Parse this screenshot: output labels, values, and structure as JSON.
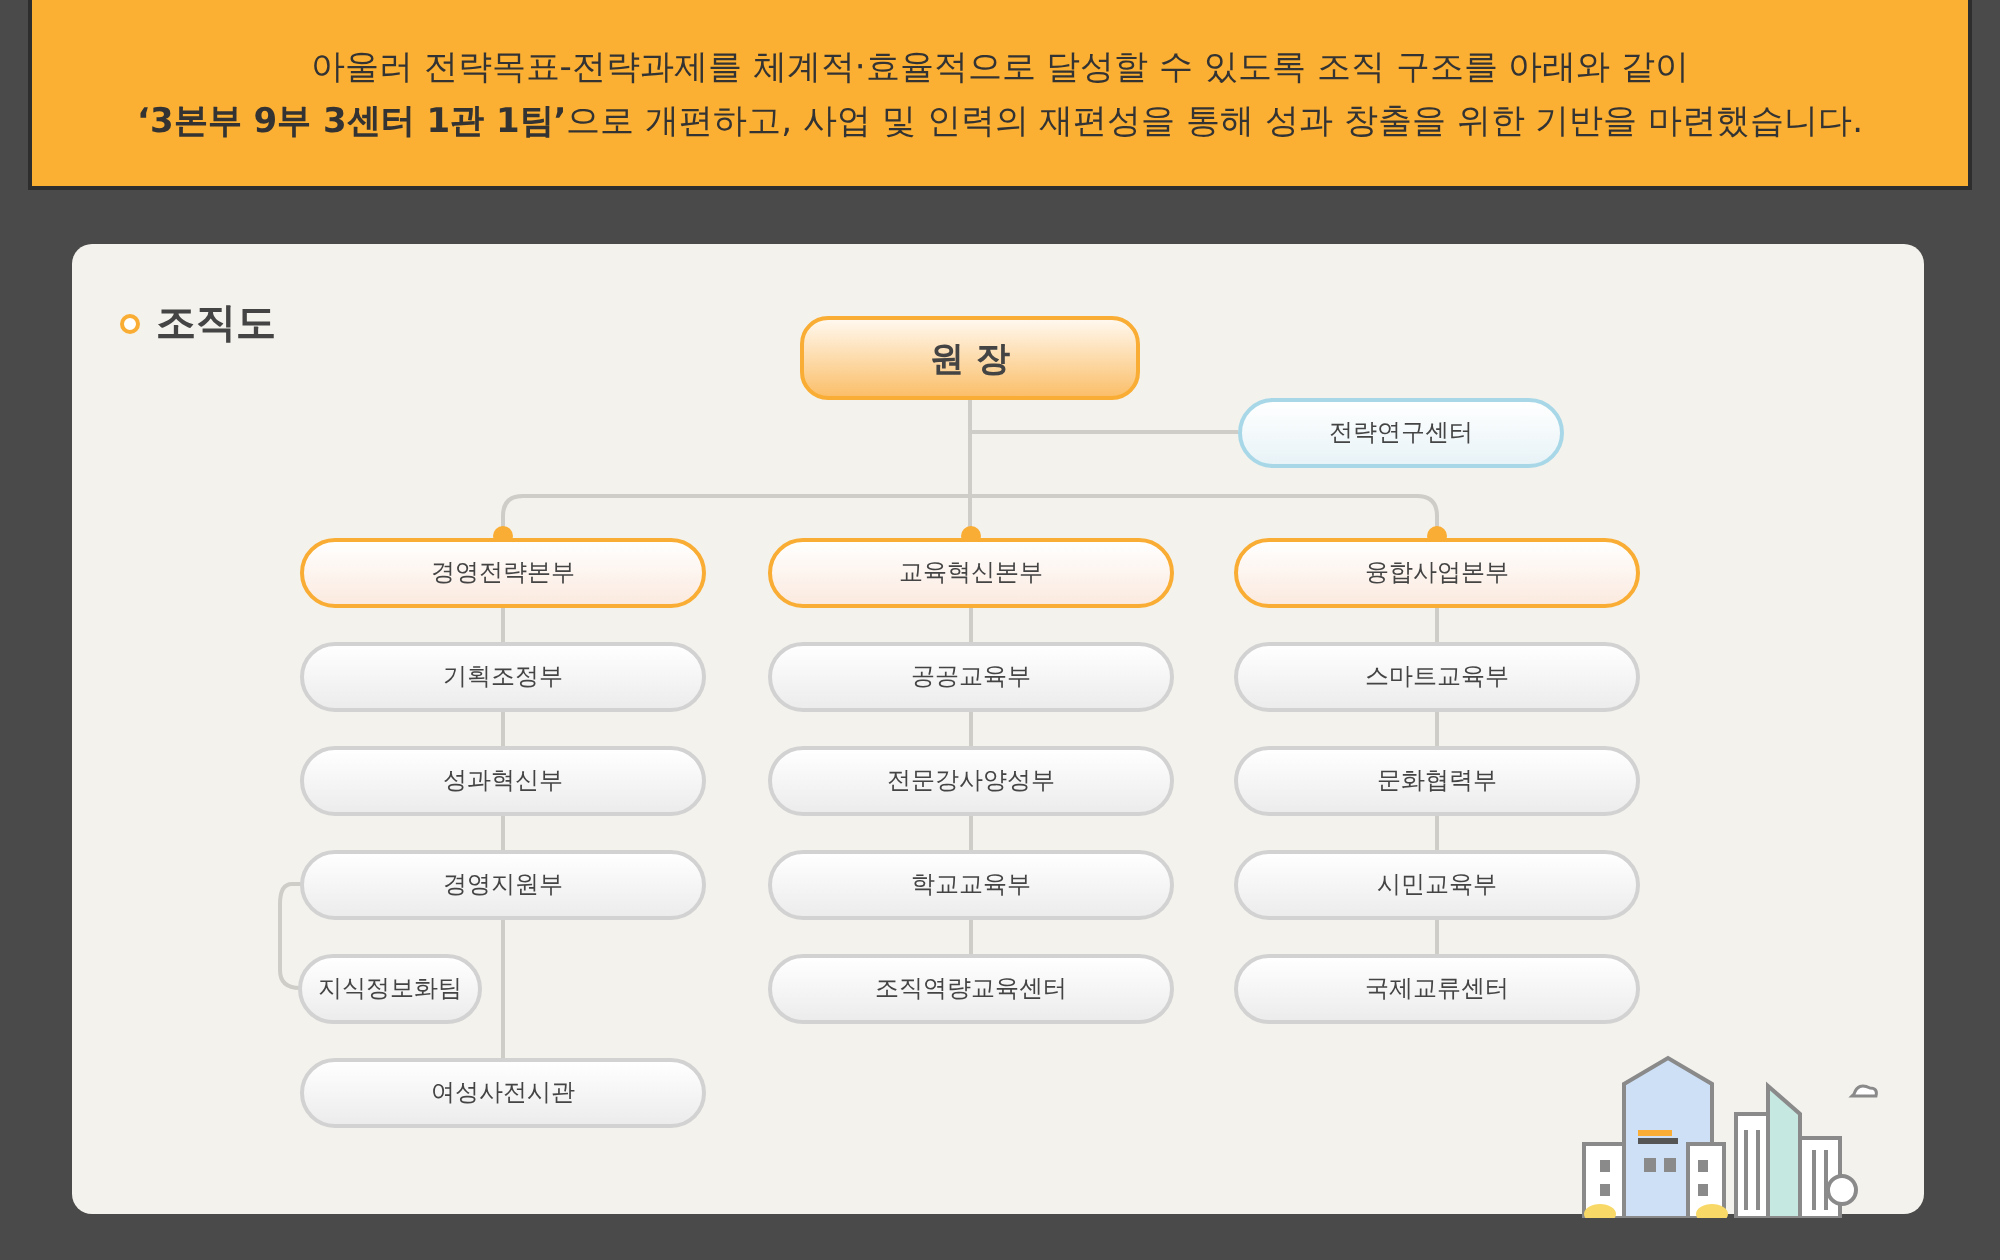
{
  "intro": {
    "lines": [
      "아울러 전략목표-전략과제를 체계적·효율적으로 달성할 수 있도록 조직 구조를 아래와 같이",
      "**‘3본부 9부 3센터 1관 1팀’**으로 개편하고, 사업 및 인력의 재편성을 통해 성과 창출을 위한 기반을 마련했습니다."
    ]
  },
  "org_chart": {
    "title": "조직도",
    "head": "원 장",
    "side_unit": "전략연구센터",
    "divisions": [
      {
        "name": "경영전략본부",
        "units": [
          {
            "name": "기획조정부"
          },
          {
            "name": "성과혁신부"
          },
          {
            "name": "경영지원부",
            "children": [
              {
                "name": "지식정보화팀"
              }
            ]
          },
          {
            "name": "여성사전시관"
          }
        ]
      },
      {
        "name": "교육혁신본부",
        "units": [
          {
            "name": "공공교육부"
          },
          {
            "name": "전문강사양성부"
          },
          {
            "name": "학교교육부"
          },
          {
            "name": "조직역량교육센터"
          }
        ]
      },
      {
        "name": "융합사업본부",
        "units": [
          {
            "name": "스마트교육부"
          },
          {
            "name": "문화협력부"
          },
          {
            "name": "시민교육부"
          },
          {
            "name": "국제교류센터"
          }
        ]
      }
    ]
  }
}
